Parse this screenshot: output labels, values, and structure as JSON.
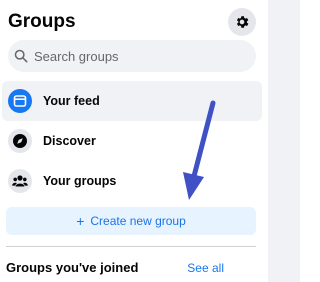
{
  "header": {
    "title": "Groups",
    "settings_icon": "gear-icon"
  },
  "search": {
    "placeholder": "Search groups",
    "value": "",
    "icon": "search-icon"
  },
  "nav": {
    "items": [
      {
        "label": "Your feed",
        "icon": "feed-icon",
        "active": true
      },
      {
        "label": "Discover",
        "icon": "compass-icon",
        "active": false
      },
      {
        "label": "Your groups",
        "icon": "people-icon",
        "active": false
      }
    ]
  },
  "create": {
    "label": "Create new group",
    "icon": "plus-icon"
  },
  "joined": {
    "title": "Groups you've joined",
    "see_all": "See all"
  },
  "annotation": {
    "icon": "arrow-icon",
    "color": "#3f51c4"
  },
  "colors": {
    "accent": "#1877f2",
    "create_bg": "#e7f3ff",
    "active_bg": "#f0f2f5",
    "panel_right_bg": "#f0f2f5"
  }
}
